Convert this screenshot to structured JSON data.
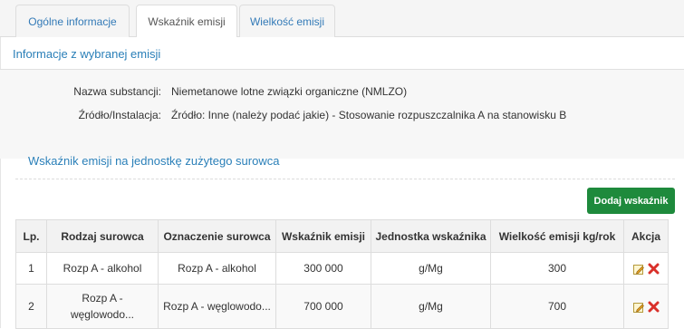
{
  "tabs": [
    {
      "label": "Ogólne informacje",
      "active": false
    },
    {
      "label": "Wskaźnik emisji",
      "active": true
    },
    {
      "label": "Wielkość emisji",
      "active": false
    }
  ],
  "info": {
    "title": "Informacje z wybranej emisji",
    "substance_label": "Nazwa substancji:",
    "substance_value": "Niemetanowe lotne związki organiczne (NMLZO)",
    "source_label": "Źródło/Instalacja:",
    "source_value": "Źródło: Inne (należy podać jakie) - Stosowanie rozpuszczalnika A na stanowisku B"
  },
  "factor": {
    "title": "Wskaźnik emisji na jednostkę zużytego surowca",
    "add_button": "Dodaj wskaźnik"
  },
  "table": {
    "headers": [
      "Lp.",
      "Rodzaj surowca",
      "Oznaczenie surowca",
      "Wskaźnik emisji",
      "Jednostka wskaźnika",
      "Wielkość emisji kg/rok",
      "Akcja"
    ],
    "rows": [
      {
        "lp": "1",
        "rodzaj": "Rozp A - alkohol",
        "oznaczenie": "Rozp A - alkohol",
        "wskaznik": "300 000",
        "jednostka": "g/Mg",
        "wielkosc": "300"
      },
      {
        "lp": "2",
        "rodzaj_line1": "Rozp A -",
        "rodzaj_line2": "węglowodo...",
        "oznaczenie": "Rozp A - węglowodo...",
        "wskaznik": "700 000",
        "jednostka": "g/Mg",
        "wielkosc": "700"
      }
    ]
  },
  "colors": {
    "accent": "#2a7fb8",
    "button": "#1e8a3c",
    "delete": "#d9302a"
  }
}
